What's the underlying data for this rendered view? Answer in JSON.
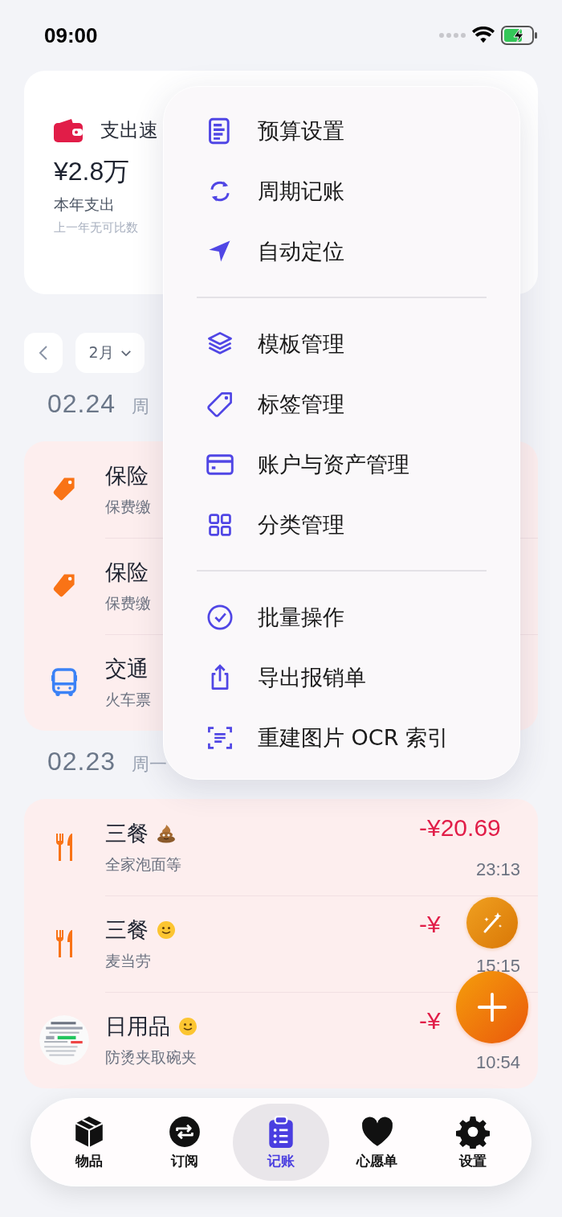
{
  "status_bar": {
    "time": "09:00"
  },
  "summary": {
    "title": "支出速",
    "amount": "¥2.8万",
    "label": "本年支出",
    "note": "上一年无可比数"
  },
  "date_nav": {
    "month": "2月"
  },
  "days": [
    {
      "date": "02.24",
      "weekday": "周",
      "entries": [
        {
          "kind": "tag",
          "title": "保险",
          "note": "保费缴"
        },
        {
          "kind": "tag",
          "title": "保险",
          "note": "保费缴"
        },
        {
          "kind": "bus",
          "title": "交通",
          "note": "火车票"
        }
      ]
    },
    {
      "date": "02.23",
      "weekday": "周一",
      "entries": [
        {
          "kind": "meal",
          "title": "三餐",
          "emoji": {
            "kind": "poo"
          },
          "note": "全家泡面等",
          "amount": "-¥20.69",
          "time": "23:13"
        },
        {
          "kind": "meal",
          "title": "三餐",
          "emoji": {
            "kind": "smile"
          },
          "note": "麦当劳",
          "amount": "-¥",
          "time": "15:15"
        },
        {
          "kind": "picture",
          "title": "日用品",
          "emoji": {
            "kind": "smile"
          },
          "note": "防烫夹取碗夹",
          "amount": "-¥",
          "time": "10:54"
        }
      ]
    }
  ],
  "menu": {
    "groups": [
      [
        {
          "kind": "doc",
          "label": "预算设置"
        },
        {
          "kind": "cycle",
          "label": "周期记账"
        },
        {
          "kind": "location",
          "label": "自动定位"
        }
      ],
      [
        {
          "kind": "layers",
          "label": "模板管理"
        },
        {
          "kind": "tag",
          "label": "标签管理"
        },
        {
          "kind": "card",
          "label": "账户与资产管理"
        },
        {
          "kind": "grid",
          "label": "分类管理"
        }
      ],
      [
        {
          "kind": "check",
          "label": "批量操作"
        },
        {
          "kind": "share",
          "label": "导出报销单"
        },
        {
          "kind": "scan",
          "label": "重建图片 OCR 索引"
        }
      ]
    ]
  },
  "tab_bar": [
    {
      "kind": "box",
      "label": "物品",
      "selected": false
    },
    {
      "kind": "repeat",
      "label": "订阅",
      "selected": false
    },
    {
      "kind": "clipboard",
      "label": "记账",
      "selected": true
    },
    {
      "kind": "heart",
      "label": "心愿单",
      "selected": false
    },
    {
      "kind": "gear",
      "label": "设置",
      "selected": false
    }
  ]
}
